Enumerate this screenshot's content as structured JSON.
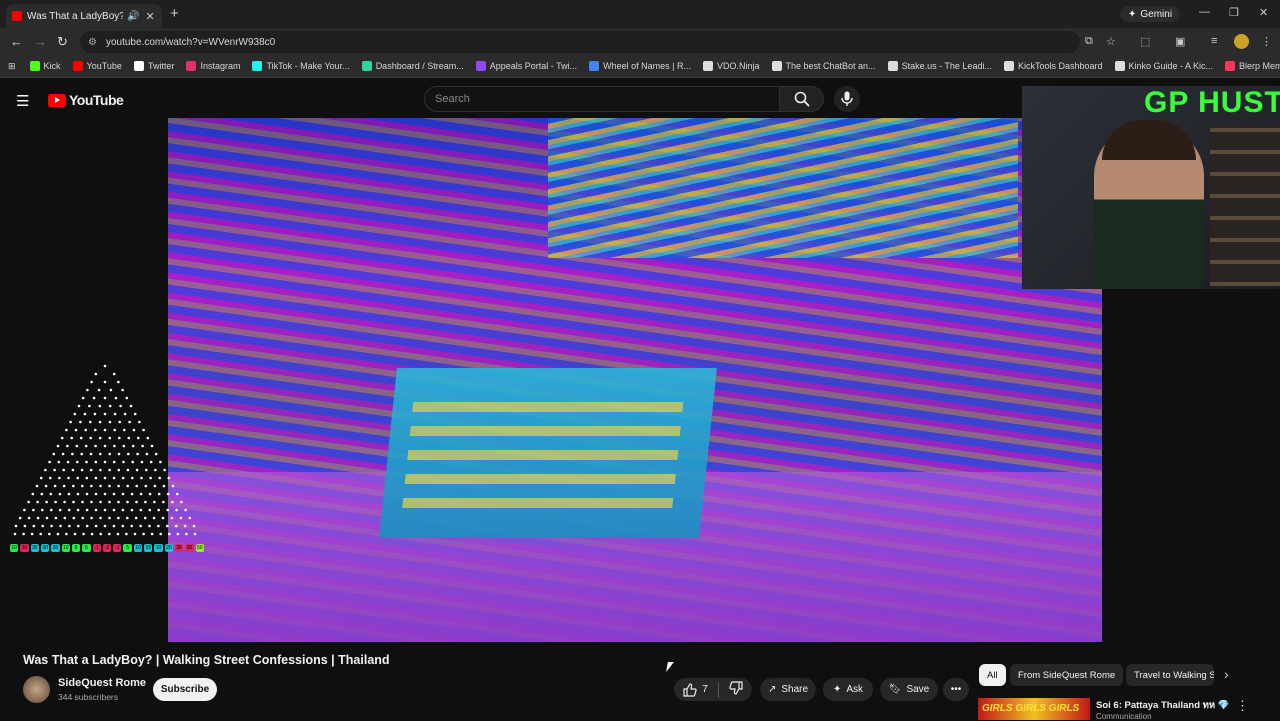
{
  "browser": {
    "tab_title": "Was That a LadyBoy? | Walk",
    "new_tab": "+",
    "gemini": "Gemini",
    "url": "youtube.com/watch?v=WVenrW938c0",
    "bookmarks": [
      {
        "label": "Kick",
        "color": "#53fc18"
      },
      {
        "label": "YouTube",
        "color": "#ff0000"
      },
      {
        "label": "Twitter",
        "color": "#ffffff"
      },
      {
        "label": "Instagram",
        "color": "#e1306c"
      },
      {
        "label": "TikTok - Make Your...",
        "color": "#25f4ee"
      },
      {
        "label": "Dashboard / Stream...",
        "color": "#2dd4a0"
      },
      {
        "label": "Appeals Portal - Twi...",
        "color": "#9146ff"
      },
      {
        "label": "Wheel of Names | R...",
        "color": "#4285f4"
      },
      {
        "label": "VDO.Ninja",
        "color": "#dddddd"
      },
      {
        "label": "The best ChatBot an...",
        "color": "#dddddd"
      },
      {
        "label": "Stake.us - The Leadi...",
        "color": "#dddddd"
      },
      {
        "label": "KickTools Dashboard",
        "color": "#dddddd"
      },
      {
        "label": "Kinko Guide - A Kic...",
        "color": "#dddddd"
      },
      {
        "label": "Blerp Memes | Best...",
        "color": "#ff3355"
      }
    ]
  },
  "youtube": {
    "logo": "YouTube",
    "search_placeholder": "Search"
  },
  "overlay": {
    "brand": "GP HUSTLA",
    "meter": [
      "10",
      "30",
      "35",
      "30",
      "35",
      "10",
      "5",
      "5",
      "-1",
      "-2",
      "-1",
      "5",
      "10",
      "15",
      "10",
      "20",
      "35",
      "30",
      "50"
    ]
  },
  "video": {
    "title": "Was That a LadyBoy? | Walking Street Confessions | Thailand",
    "channel": "SideQuest Rome",
    "subscribers": "344 subscribers",
    "subscribe": "Subscribe",
    "likes": "7",
    "share": "Share",
    "ask": "Ask",
    "save": "Save"
  },
  "chips": [
    "All",
    "From SideQuest Rome",
    "Travel to Walking S"
  ],
  "related": {
    "thumb_text": "GIRLS GIRLS GIRLS",
    "title": "Soi 6: Pattaya Thailand ทห 💎",
    "sub": "Communication"
  }
}
